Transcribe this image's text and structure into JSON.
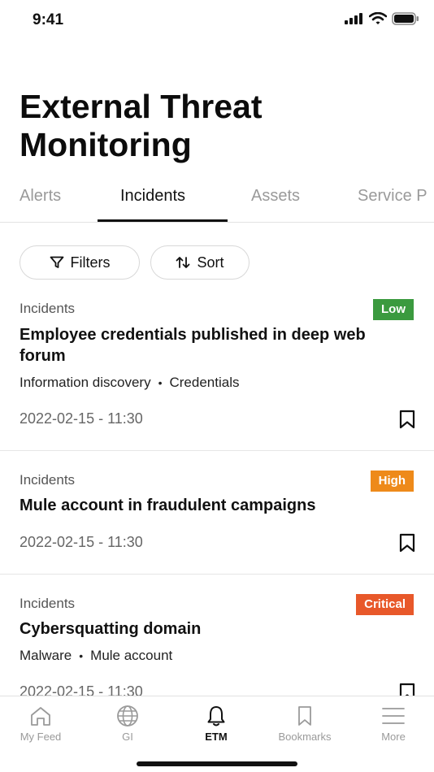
{
  "status_bar": {
    "time": "9:41"
  },
  "page": {
    "title": "External Threat Monitoring"
  },
  "tabs": [
    {
      "label": "Alerts"
    },
    {
      "label": "Incidents"
    },
    {
      "label": "Assets"
    },
    {
      "label": "Service P"
    }
  ],
  "active_tab": "Incidents",
  "controls": {
    "filters_label": "Filters",
    "sort_label": "Sort"
  },
  "cards": [
    {
      "category": "Incidents",
      "severity": "Low",
      "severity_color": "#3b9a3f",
      "title": "Employee credentials published in deep web forum",
      "tags": [
        "Information discovery",
        "Credentials"
      ],
      "date": "2022-02-15 - 11:30"
    },
    {
      "category": "Incidents",
      "severity": "High",
      "severity_color": "#ee8a1a",
      "title": "Mule account in fraudulent campaigns",
      "tags": [],
      "date": "2022-02-15 - 11:30"
    },
    {
      "category": "Incidents",
      "severity": "Critical",
      "severity_color": "#e8582a",
      "title": "Cybersquatting domain",
      "tags": [
        "Malware",
        "Mule account"
      ],
      "date": "2022-02-15 - 11:30"
    }
  ],
  "bottom_nav": [
    {
      "label": "My Feed",
      "icon": "home-icon"
    },
    {
      "label": "GI",
      "icon": "globe-icon"
    },
    {
      "label": "ETM",
      "icon": "bell-icon"
    },
    {
      "label": "Bookmarks",
      "icon": "bookmark-icon"
    },
    {
      "label": "More",
      "icon": "menu-icon"
    }
  ],
  "active_nav": "ETM"
}
